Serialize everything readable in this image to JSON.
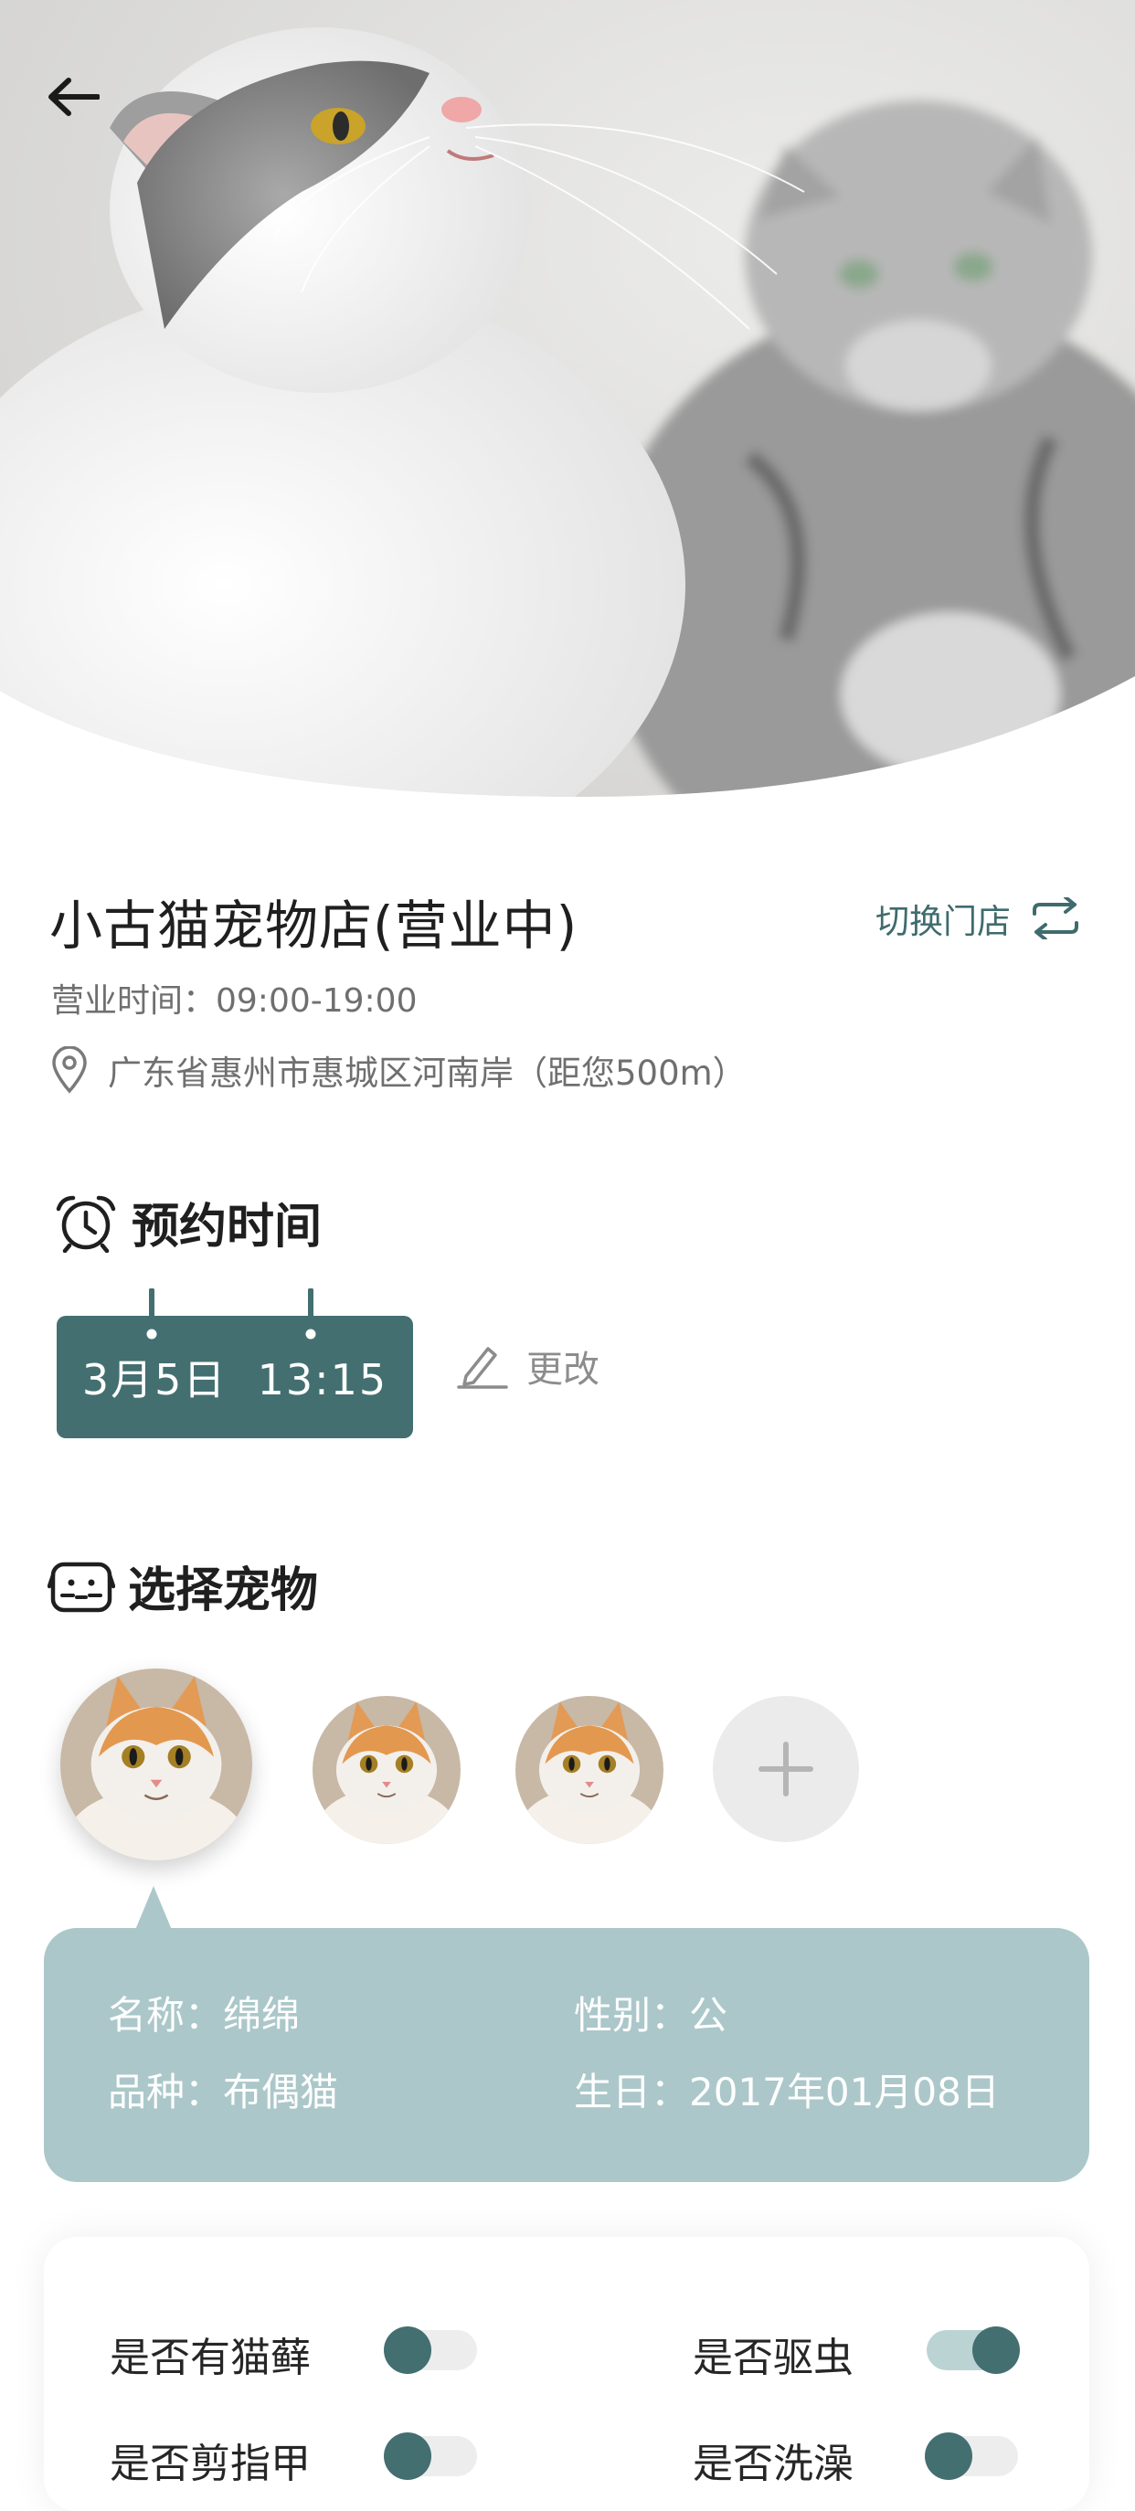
{
  "shop": {
    "name": "小古猫宠物店(营业中)",
    "switch_label": "切换门店",
    "hours": "营业时间：09:00-19:00",
    "address": "广东省惠州市惠城区河南岸（距您500m）"
  },
  "appointment": {
    "title": "预约时间",
    "date_time": "3月5日  13:15",
    "change_label": "更改"
  },
  "pets": {
    "title": "选择宠物",
    "selected": {
      "name_label": "名称：",
      "name": "绵绵",
      "breed_label": "品种：",
      "breed": "布偶猫",
      "gender_label": "性别：",
      "gender": "公",
      "birthday_label": "生日：",
      "birthday": "2017年01月08日"
    }
  },
  "options": [
    {
      "label": "是否有猫藓",
      "on": false
    },
    {
      "label": "是否驱虫",
      "on": true
    },
    {
      "label": "是否剪指甲",
      "on": false
    },
    {
      "label": "是否洗澡",
      "on": false
    }
  ],
  "colors": {
    "primary": "#436f71",
    "card_bg": "#abc7c9",
    "accent_text": "#3f6b6e"
  }
}
